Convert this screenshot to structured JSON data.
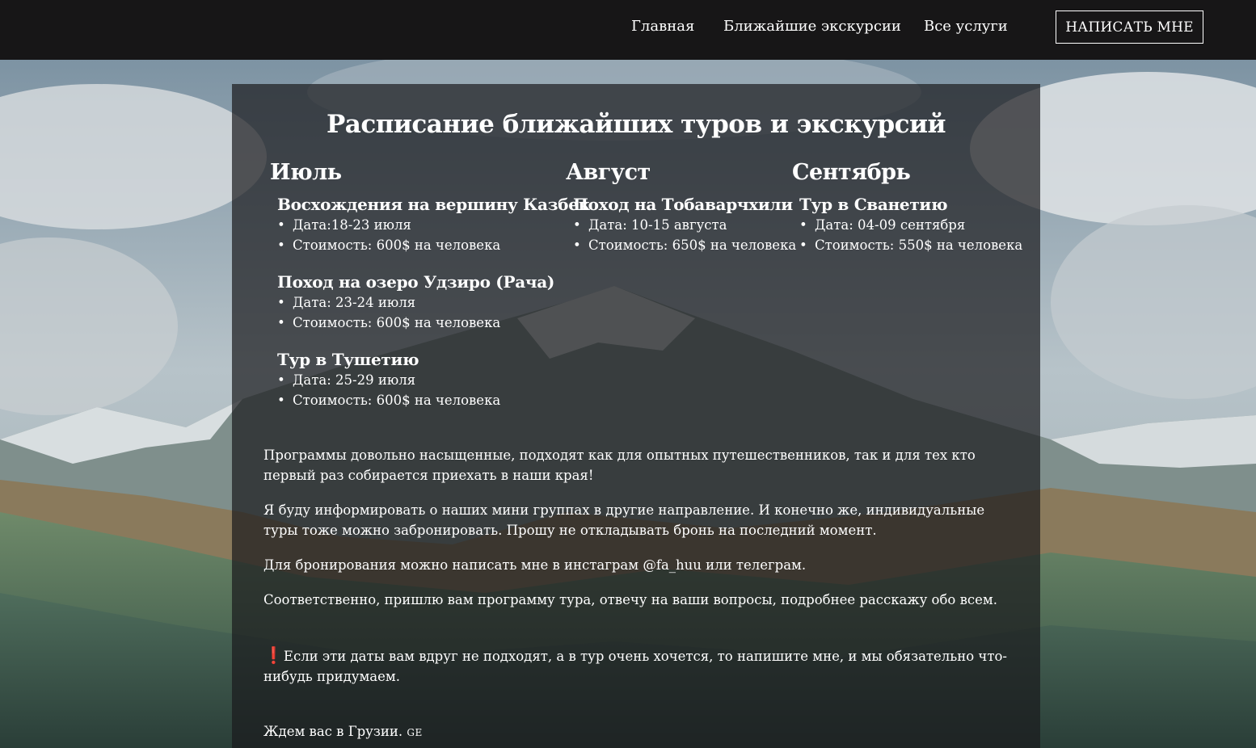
{
  "nav": {
    "links": [
      "Главная",
      "Ближайшие экскурсии",
      "Все услуги"
    ],
    "contact_button": "НАПИСАТЬ МНЕ"
  },
  "schedule": {
    "title": "Расписание ближайших туров и экскурсий",
    "months": [
      {
        "name": "Июль",
        "tours": [
          {
            "name": "Восхождения на вершину Казбек",
            "date": "Дата:18-23 июля",
            "price": "Стоимость: 600$ на человека"
          },
          {
            "name": "Поход на озеро Удзиро (Рача)",
            "date": "Дата: 23-24 июля",
            "price": "Стоимость: 600$ на человека"
          },
          {
            "name": "Тур в Тушетию",
            "date": "Дата: 25-29 июля",
            "price": "Стоимость: 600$ на человека"
          }
        ]
      },
      {
        "name": "Август",
        "tours": [
          {
            "name": "Поход на Тобаварчхили",
            "date": "Дата: 10-15 августа",
            "price": "Стоимость: 650$ на человека"
          }
        ]
      },
      {
        "name": "Сентябрь",
        "tours": [
          {
            "name": "Тур в Сванетию",
            "date": "Дата: 04-09 сентября",
            "price": "Стоимость: 550$ на человека"
          }
        ]
      }
    ]
  },
  "text": {
    "p1": "Программы довольно насыщенные, подходят как для опытных путешественников, так и для тех кто первый раз собирается приехать в наши края!",
    "p2": "Я буду информировать о наших мини группах в другие направление. И конечно же, индивидуальные туры тоже можно забронировать. Прошу не откладывать бронь на последний момент.",
    "p3": "Для бронирования можно написать мне в инстаграм @fa_huu или телеграм.",
    "p4": "Соответственно, пришлю вам программу тура, отвечу на ваши вопросы, подробнее расскажу обо всем.",
    "warning_icon": "❗",
    "warning": "Если эти даты вам вдруг не подходят, а в тур очень хочется, то напишите мне, и мы обязательно что-нибудь придумаем.",
    "closing": "Ждем вас в Грузии.",
    "flag": "GE"
  }
}
